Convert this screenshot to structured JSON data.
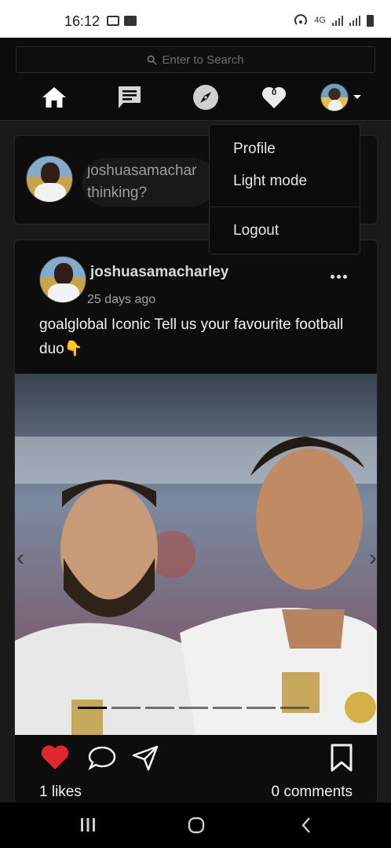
{
  "status_bar": {
    "time": "16:12",
    "network": "4G"
  },
  "header": {
    "search_placeholder": "Enter to Search",
    "nav": [
      {
        "icon": "home-icon"
      },
      {
        "icon": "messages-icon"
      },
      {
        "icon": "explore-icon"
      },
      {
        "icon": "heart-icon",
        "count": "0"
      },
      {
        "icon": "avatar"
      }
    ]
  },
  "composer": {
    "prompt": "joshuasamachar\nthinking?"
  },
  "menu": {
    "items": [
      "Profile",
      "Light mode",
      "Logout"
    ]
  },
  "post": {
    "username": "joshuasamacharley",
    "time_ago": "25 days ago",
    "caption": "goalglobal Iconic Tell us your favourite football duo👇",
    "carousel_active_index": 0,
    "carousel_count": 7,
    "likes_text": "1 likes",
    "comments_text": "0 comments",
    "liked": true
  },
  "colors": {
    "accent_like": "#e0262f",
    "background": "#1a1a1a",
    "card": "#0d0d0d"
  }
}
